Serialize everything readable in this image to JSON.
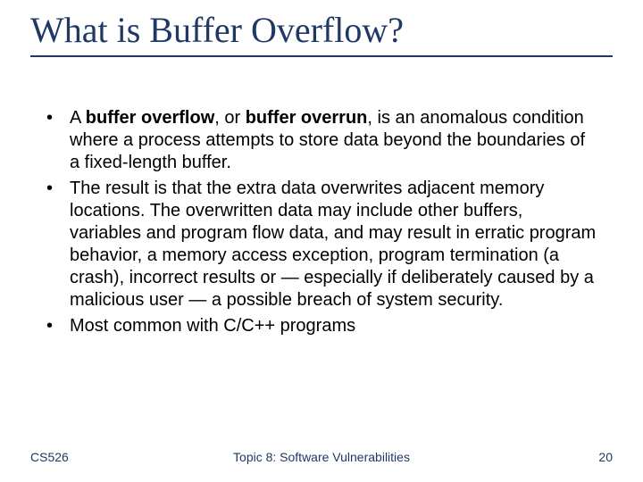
{
  "title": "What is Buffer Overflow?",
  "bullets": {
    "b1_pre": "A ",
    "b1_bold1": "buffer overflow",
    "b1_mid": ", or ",
    "b1_bold2": "buffer overrun",
    "b1_post": ", is an anomalous condition where a process attempts to store data beyond the boundaries of a fixed-length buffer.",
    "b2": "The result is that the extra data overwrites adjacent memory locations. The overwritten data may include other buffers, variables and program flow data, and may result in erratic program behavior, a memory access exception, program termination (a crash), incorrect results or — especially if deliberately caused by a malicious user — a possible breach of system security.",
    "b3": "Most common with C/C++ programs"
  },
  "footer": {
    "left": "CS526",
    "center": "Topic 8: Software Vulnerabilities",
    "right": "20"
  }
}
